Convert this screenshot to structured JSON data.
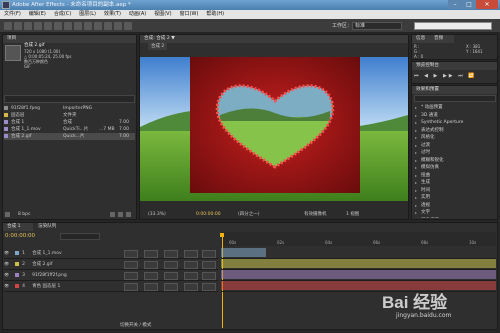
{
  "window": {
    "title": "Adobe After Effects - 未命名项目的副本.aep *"
  },
  "menu": [
    "文件(F)",
    "编辑(E)",
    "合成(C)",
    "图层(L)",
    "效果(T)",
    "动画(A)",
    "视图(V)",
    "窗口(W)",
    "帮助(H)"
  ],
  "toolbar": {
    "workspace_label": "工作区：",
    "workspace_value": "标准"
  },
  "project": {
    "tab": "项目",
    "comp_name": "合成 2.gif",
    "comp_info_1": "720 x 1080 (1.00)",
    "comp_info_2": "△ 0:00:05:24, 25.00 fps",
    "comp_info_3": "数百万种颜色",
    "comp_info_4": "GIF",
    "items": [
      {
        "name": "91f28f1.fpeg",
        "type": "ImporterPNG"
      },
      {
        "name": "固态层",
        "type": "文件夹"
      },
      {
        "name": "合成 1",
        "type": "合成",
        "fps": "7.00"
      },
      {
        "name": "合成 1_1.mov",
        "type": "QuickTi...片",
        "size": "...7 MB",
        "fps": "7.00"
      },
      {
        "name": "合成 2.gif",
        "type": "Quick...片",
        "fps": "7.00"
      }
    ],
    "bpc": "8 bpc"
  },
  "composition": {
    "tab": "合成: 合成 2 ▼",
    "breadcrumb": "合成 2",
    "zoom": "(33.3%)",
    "timecode": "0:00:00:00",
    "resolution": "(四分之一)",
    "camera": "有效摄像机",
    "view": "1 视图"
  },
  "info": {
    "tab_info": "信息",
    "tab_audio": "音频",
    "r": "R :",
    "g": "G :",
    "b": "B :",
    "a": "A : 0",
    "x": "X : 381",
    "y": "Y : 1641"
  },
  "preview": {
    "tab": "预览控制台"
  },
  "effects": {
    "tab": "效果和预置",
    "items": [
      "* 动画预置",
      "3D 通道",
      "Synthetic Aperture",
      "表达式控制",
      "风格化",
      "过渡",
      "过时",
      "模糊和锐化",
      "模拟仿真",
      "扭曲",
      "生成",
      "时间",
      "实用",
      "透视",
      "文字",
      "颜色校正",
      "音频",
      "杂色和颗粒",
      "遮罩"
    ]
  },
  "timeline": {
    "tab1": "合成 1",
    "tab2": "渲染队列",
    "timecode": "0:00:00:00",
    "ruler": [
      "00s",
      "02s",
      "04s",
      "06s",
      "08s",
      "10s"
    ],
    "layers": [
      {
        "num": "1",
        "name": "合成 1_1.mov",
        "color": "#7fa7c6"
      },
      {
        "num": "2",
        "name": "合成 2.gif",
        "color": "#c9c14a"
      },
      {
        "num": "3",
        "name": "91f28f1ff2f.png",
        "color": "#a07fc0"
      },
      {
        "num": "4",
        "name": "青色 固态层 1",
        "color": "#d04646"
      }
    ],
    "footer": "切换开关 / 模式"
  },
  "watermark": {
    "brand": "Bai 经验",
    "url": "jingyan.baidu.com"
  },
  "colors": {
    "title": "#5a8dbf",
    "menu": "#e4e4e4",
    "panel": "#2f2f2f",
    "accent": "#f0b400"
  }
}
